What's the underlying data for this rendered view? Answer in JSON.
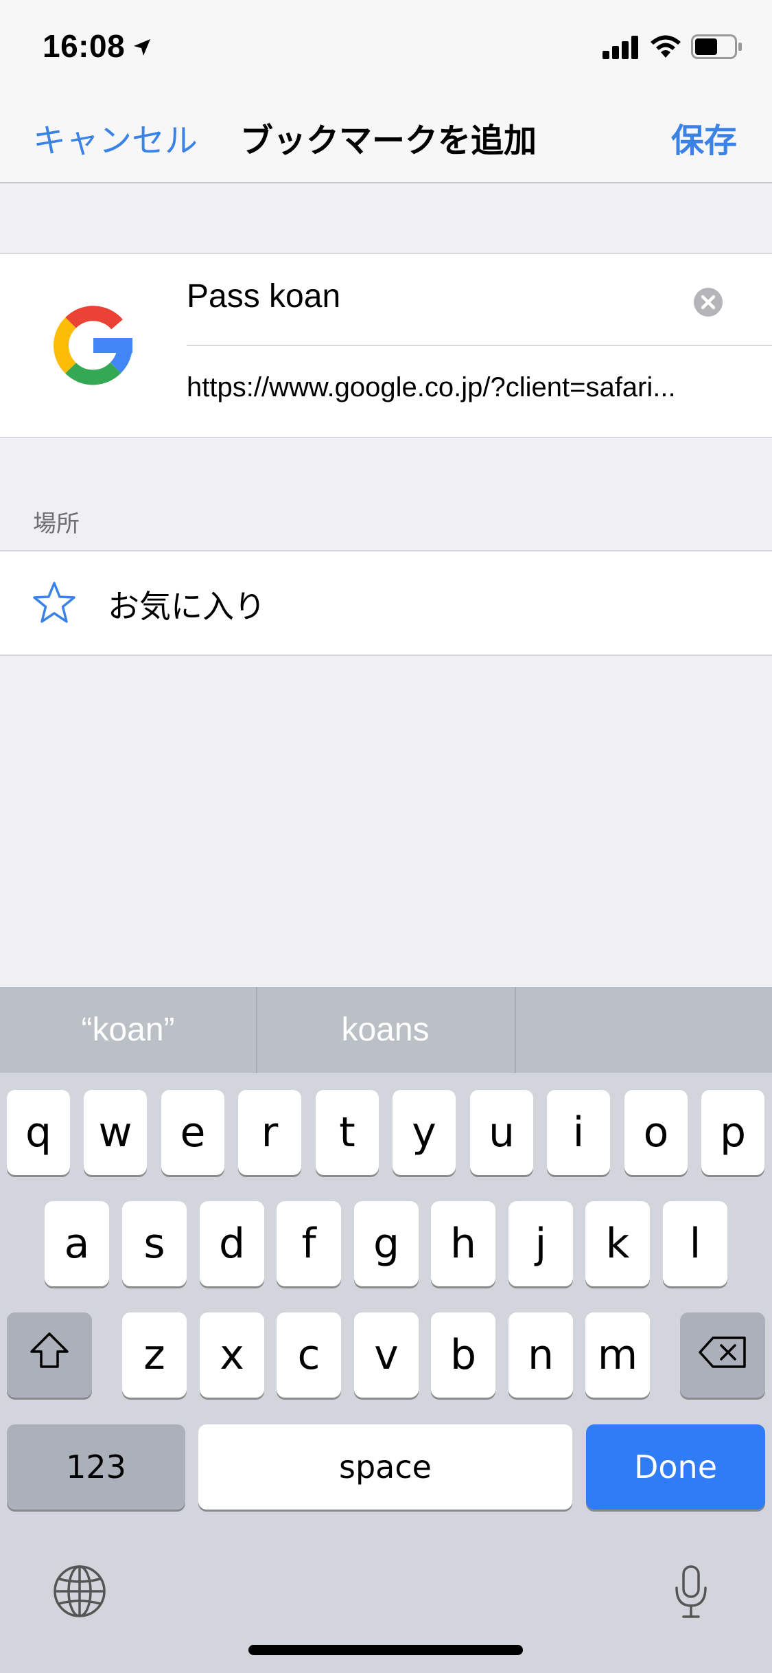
{
  "status_bar": {
    "time": "16:08"
  },
  "nav": {
    "cancel": "キャンセル",
    "title": "ブックマークを追加",
    "save": "保存"
  },
  "bookmark": {
    "title_value": "Pass koan",
    "url": "https://www.google.co.jp/?client=safari..."
  },
  "location": {
    "header": "場所",
    "folder": "お気に入り"
  },
  "keyboard": {
    "suggestions": [
      "“koan”",
      "koans",
      ""
    ],
    "row1": [
      "q",
      "w",
      "e",
      "r",
      "t",
      "y",
      "u",
      "i",
      "o",
      "p"
    ],
    "row2": [
      "a",
      "s",
      "d",
      "f",
      "g",
      "h",
      "j",
      "k",
      "l"
    ],
    "row3": [
      "z",
      "x",
      "c",
      "v",
      "b",
      "n",
      "m"
    ],
    "numbers_key": "123",
    "space_key": "space",
    "done_key": "Done"
  },
  "colors": {
    "accent": "#3b82e6",
    "done_key": "#2f7cf6",
    "background": "#efeff4"
  },
  "icons": {
    "location_arrow": "location-arrow-icon",
    "signal": "cellular-signal-icon",
    "wifi": "wifi-icon",
    "battery": "battery-icon",
    "favicon": "google-logo-icon",
    "clear": "clear-icon",
    "star": "star-icon",
    "shift": "shift-icon",
    "delete": "delete-icon",
    "globe": "globe-icon",
    "mic": "mic-icon"
  }
}
